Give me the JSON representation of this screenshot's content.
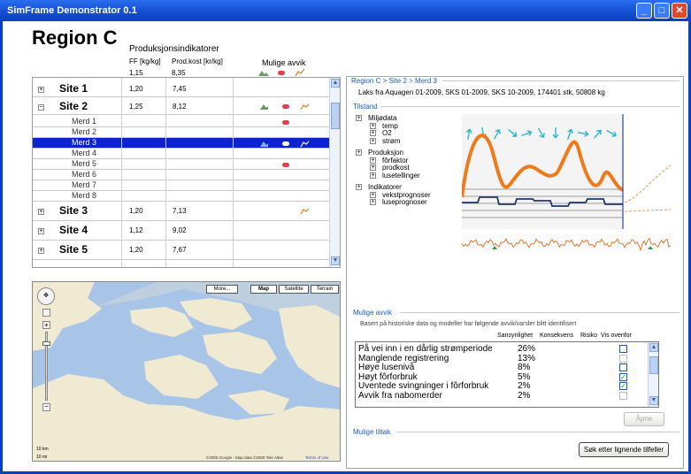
{
  "window": {
    "title": "SimFrame Demonstrator 0.1"
  },
  "page": {
    "region_title": "Region C",
    "indicators_title": "Produksjonsindikatorer",
    "col_ff": "FF [kg/kg]",
    "col_prod": "Prod.kost [kr/kg]",
    "avg_ff": "1,15",
    "avg_prod": "8,35",
    "avvik_title": "Mulige avvik"
  },
  "sites": [
    {
      "name": "Site 1",
      "ff": "1,20",
      "prod": "7,45",
      "expand": "+",
      "sub": false,
      "selected": false,
      "icons": []
    },
    {
      "name": "Site 2",
      "ff": "1,25",
      "prod": "8,12",
      "expand": "−",
      "sub": false,
      "selected": false,
      "icons": [
        "hills-icon",
        "pill-icon",
        "chart-icon"
      ]
    },
    {
      "name": "Merd 1",
      "ff": "",
      "prod": "",
      "expand": "",
      "sub": true,
      "selected": false,
      "icons": [
        "pill-icon"
      ]
    },
    {
      "name": "Merd 2",
      "ff": "",
      "prod": "",
      "expand": "",
      "sub": true,
      "selected": false,
      "icons": []
    },
    {
      "name": "Merd 3",
      "ff": "",
      "prod": "",
      "expand": "",
      "sub": true,
      "selected": true,
      "icons": [
        "hills-icon",
        "pill-icon",
        "chart-icon"
      ]
    },
    {
      "name": "Merd 4",
      "ff": "",
      "prod": "",
      "expand": "",
      "sub": true,
      "selected": false,
      "icons": []
    },
    {
      "name": "Merd 5",
      "ff": "",
      "prod": "",
      "expand": "",
      "sub": true,
      "selected": false,
      "icons": [
        "pill-icon"
      ]
    },
    {
      "name": "Merd 6",
      "ff": "",
      "prod": "",
      "expand": "",
      "sub": true,
      "selected": false,
      "icons": []
    },
    {
      "name": "Merd 7",
      "ff": "",
      "prod": "",
      "expand": "",
      "sub": true,
      "selected": false,
      "icons": []
    },
    {
      "name": "Merd 8",
      "ff": "",
      "prod": "",
      "expand": "",
      "sub": true,
      "selected": false,
      "icons": []
    },
    {
      "name": "Site 3",
      "ff": "1,20",
      "prod": "7,13",
      "expand": "+",
      "sub": false,
      "selected": false,
      "icons": [
        "chart-icon"
      ]
    },
    {
      "name": "Site 4",
      "ff": "1,12",
      "prod": "9,02",
      "expand": "+",
      "sub": false,
      "selected": false,
      "icons": []
    },
    {
      "name": "Site 5",
      "ff": "1,20",
      "prod": "7,67",
      "expand": "+",
      "sub": false,
      "selected": false,
      "icons": []
    }
  ],
  "map": {
    "buttons": [
      "More...",
      "Map",
      "Satellite",
      "Terrain"
    ],
    "active": "Map",
    "scale_km": "10 km",
    "scale_mi": "10 mi",
    "attribution": "©2009 Google - Map data ©2009 Tele Atlas",
    "terms": "Terms of Use"
  },
  "detail": {
    "breadcrumb": "Region C > Site 2 > Merd 3",
    "description": "Laks fra Aquagen 01-2009, SKS 01-2009, SKS 10-2009, 174401 stk, 50808 kg",
    "tilstand_title": "Tilstand",
    "tree": [
      {
        "label": "Miljødata",
        "indent": 0
      },
      {
        "label": "temp",
        "indent": 1
      },
      {
        "label": "O2",
        "indent": 1
      },
      {
        "label": "strøm",
        "indent": 1
      },
      {
        "label": "Produksjon",
        "indent": 0
      },
      {
        "label": "fôrfaktor",
        "indent": 1
      },
      {
        "label": "prodkost",
        "indent": 1
      },
      {
        "label": "lusetellinger",
        "indent": 1
      },
      {
        "label": "Indikatorer",
        "indent": 0
      },
      {
        "label": "vekstprognoser",
        "indent": 1
      },
      {
        "label": "luseprognoser",
        "indent": 1
      }
    ],
    "avvik_title": "Mulige avvik",
    "avvik_intro": "Basert på historiske data og modeller har følgende avvik/varsler blitt identifisert",
    "col_sans": "Sansynlighet",
    "col_kons": "Konsekvens",
    "col_risiko": "Risiko",
    "col_vis": "Vis ovenfor",
    "avvik": [
      {
        "label": "På vei inn i en dårlig strømperiode",
        "p": "26%",
        "checked": false,
        "enabled": true
      },
      {
        "label": "Manglende registrering",
        "p": "13%",
        "checked": false,
        "enabled": false
      },
      {
        "label": "Høye lusenivå",
        "p": "8%",
        "checked": false,
        "enabled": true
      },
      {
        "label": "Høyt fôrforbruk",
        "p": "5%",
        "checked": true,
        "enabled": true
      },
      {
        "label": "Uventede svingninger i fôrforbruk",
        "p": "2%",
        "checked": true,
        "enabled": true
      },
      {
        "label": "Avvik fra nabomerder",
        "p": "2%",
        "checked": false,
        "enabled": false
      }
    ],
    "open_button": "Åpne",
    "tiltak_title": "Mulige tiltak",
    "search_button": "Søk etter lignende tilfeller"
  },
  "colors": {
    "accent": "#0a24d0",
    "curve": "#f07a1a",
    "arrow": "#2ab8c8"
  }
}
